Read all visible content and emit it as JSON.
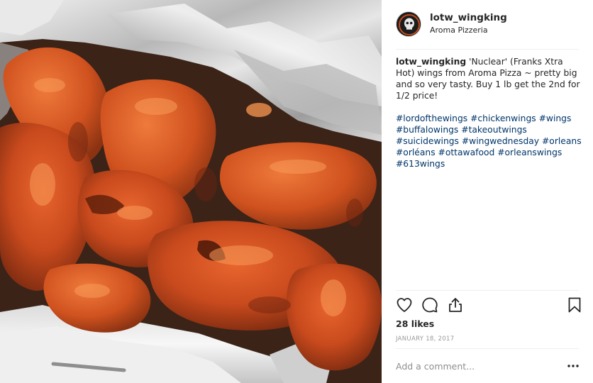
{
  "post": {
    "image_alt": "Plate of fried chicken wings in aluminium foil",
    "header": {
      "username": "lotw_wingking",
      "location": "Aroma Pizzeria"
    },
    "caption": {
      "username": "lotw_wingking",
      "text": "'Nuclear' (Franks Xtra Hot) wings from Aroma Pizza ~ pretty big and so very tasty. Buy 1 lb get the 2nd for 1/2 price!",
      "hashtags": [
        "#lordofthewings",
        "#chickenwings",
        "#wings",
        "#buffalowings",
        "#takeoutwings",
        "#suicidewings",
        "#wingwednesday",
        "#orleans",
        "#orléans",
        "#ottawafood",
        "#orleanswings",
        "#613wings"
      ]
    },
    "actions": {
      "like_icon": "heart-icon",
      "comment_icon": "comment-bubble-icon",
      "share_icon": "share-icon",
      "save_icon": "bookmark-icon"
    },
    "likes": "28 likes",
    "date": "JANUARY 18, 2017",
    "comment_box": {
      "placeholder": "Add a comment...",
      "value": ""
    },
    "more_icon": "more-horizontal-icon"
  },
  "colors": {
    "text": "#262626",
    "hashtag": "#003569",
    "muted": "#999999",
    "divider": "#efefef"
  }
}
